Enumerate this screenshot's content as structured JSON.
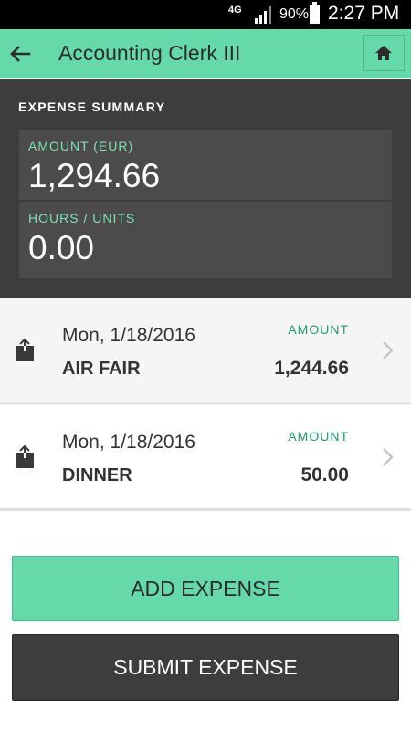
{
  "status_bar": {
    "network": "4G",
    "battery_percent": "90%",
    "time": "2:27 PM"
  },
  "header": {
    "title": "Accounting Clerk III",
    "back_icon": "back-arrow-icon",
    "home_icon": "home-icon"
  },
  "summary": {
    "title": "EXPENSE SUMMARY",
    "amount_label": "AMOUNT (EUR)",
    "amount_value": "1,294.66",
    "hours_label": "HOURS / UNITS",
    "hours_value": "0.00"
  },
  "expenses": [
    {
      "date": "Mon, 1/18/2016",
      "name": "AIR FAIR",
      "amount_label": "AMOUNT",
      "amount": "1,244.66"
    },
    {
      "date": "Mon, 1/18/2016",
      "name": "DINNER",
      "amount_label": "AMOUNT",
      "amount": "50.00"
    }
  ],
  "actions": {
    "add_label": "ADD EXPENSE",
    "submit_label": "SUBMIT EXPENSE"
  },
  "colors": {
    "accent": "#66d9aa",
    "dark": "#3d3d3d",
    "amount_label": "#1f9e6b"
  }
}
